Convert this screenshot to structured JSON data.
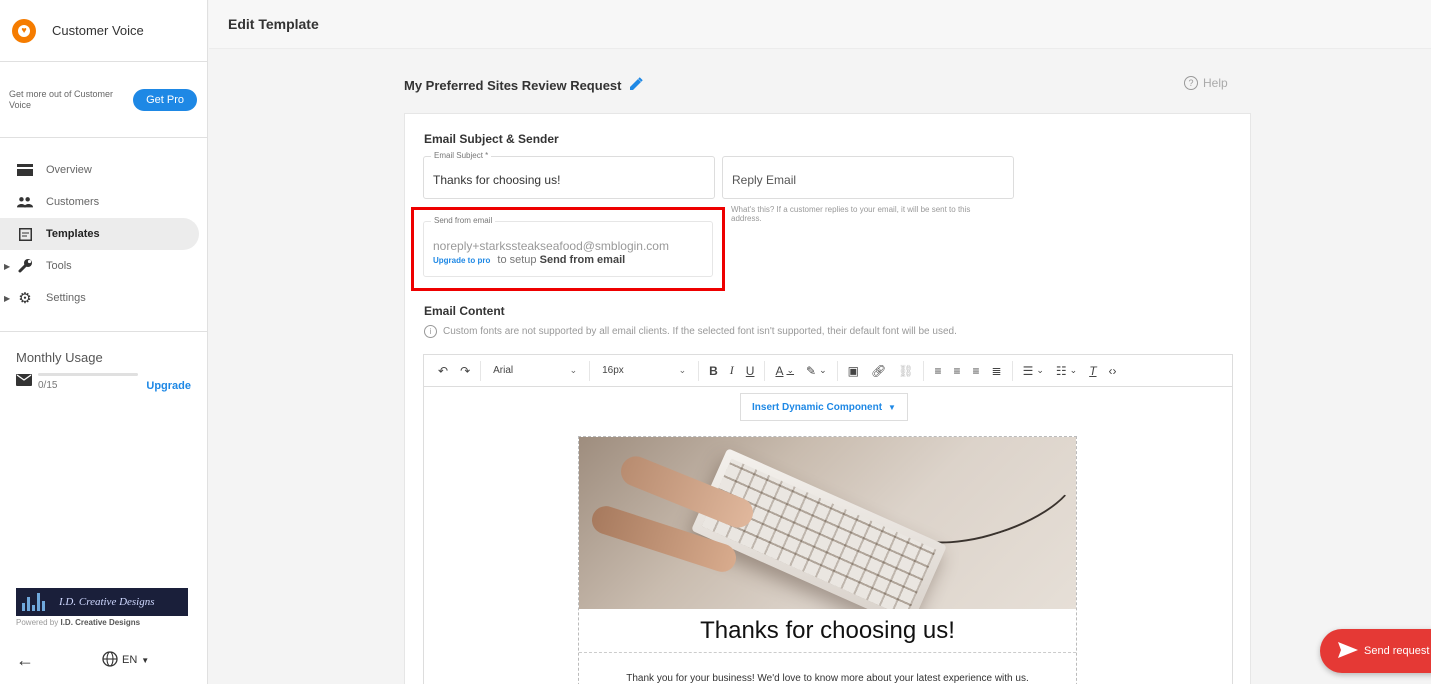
{
  "app": {
    "name": "Customer Voice",
    "promo_text": "Get more out of Customer Voice",
    "get_pro_label": "Get Pro"
  },
  "sidebar": {
    "items": [
      {
        "label": "Overview",
        "icon": "overview-icon"
      },
      {
        "label": "Customers",
        "icon": "customers-icon"
      },
      {
        "label": "Templates",
        "icon": "templates-icon",
        "active": true
      },
      {
        "label": "Tools",
        "icon": "wrench-icon",
        "expandable": true
      },
      {
        "label": "Settings",
        "icon": "gear-icon",
        "expandable": true
      }
    ],
    "usage": {
      "title": "Monthly Usage",
      "count": "0/15",
      "upgrade_label": "Upgrade"
    },
    "brand": {
      "name": "I.D. Creative Designs",
      "powered_prefix": "Powered by",
      "powered_name": "I.D. Creative Designs"
    },
    "footer": {
      "language": "EN"
    }
  },
  "header": {
    "page_title": "Edit Template"
  },
  "template": {
    "name": "My Preferred Sites Review Request",
    "help_label": "Help"
  },
  "email_subject_sender": {
    "section_title": "Email Subject & Sender",
    "subject_legend": "Email Subject *",
    "subject_value": "Thanks for choosing us!",
    "reply_placeholder": "Reply Email",
    "reply_helper": "What's this? If a customer replies to your email, it will be sent to this address.",
    "from_legend": "Send from email",
    "from_value": "noreply+starkssteakseafood@smblogin.com",
    "upgrade_to_pro": "Upgrade to pro",
    "setup_text": "to setup",
    "setup_bold": "Send from email"
  },
  "email_content": {
    "section_title": "Email Content",
    "info_text": "Custom fonts are not supported by all email clients. If the selected font isn't supported, their default font will be used.",
    "toolbar": {
      "font": "Arial",
      "size": "16px"
    },
    "insert_dynamic_label": "Insert Dynamic Component",
    "preview_heading": "Thanks for choosing us!",
    "preview_body": "Thank you for your business! We'd love to know more about your latest experience with us."
  },
  "send_request_label": "Send request",
  "colors": {
    "accent": "#1e88e5",
    "logo": "#f57c00",
    "send_button": "#e53935",
    "highlight_border": "#ee0000"
  }
}
